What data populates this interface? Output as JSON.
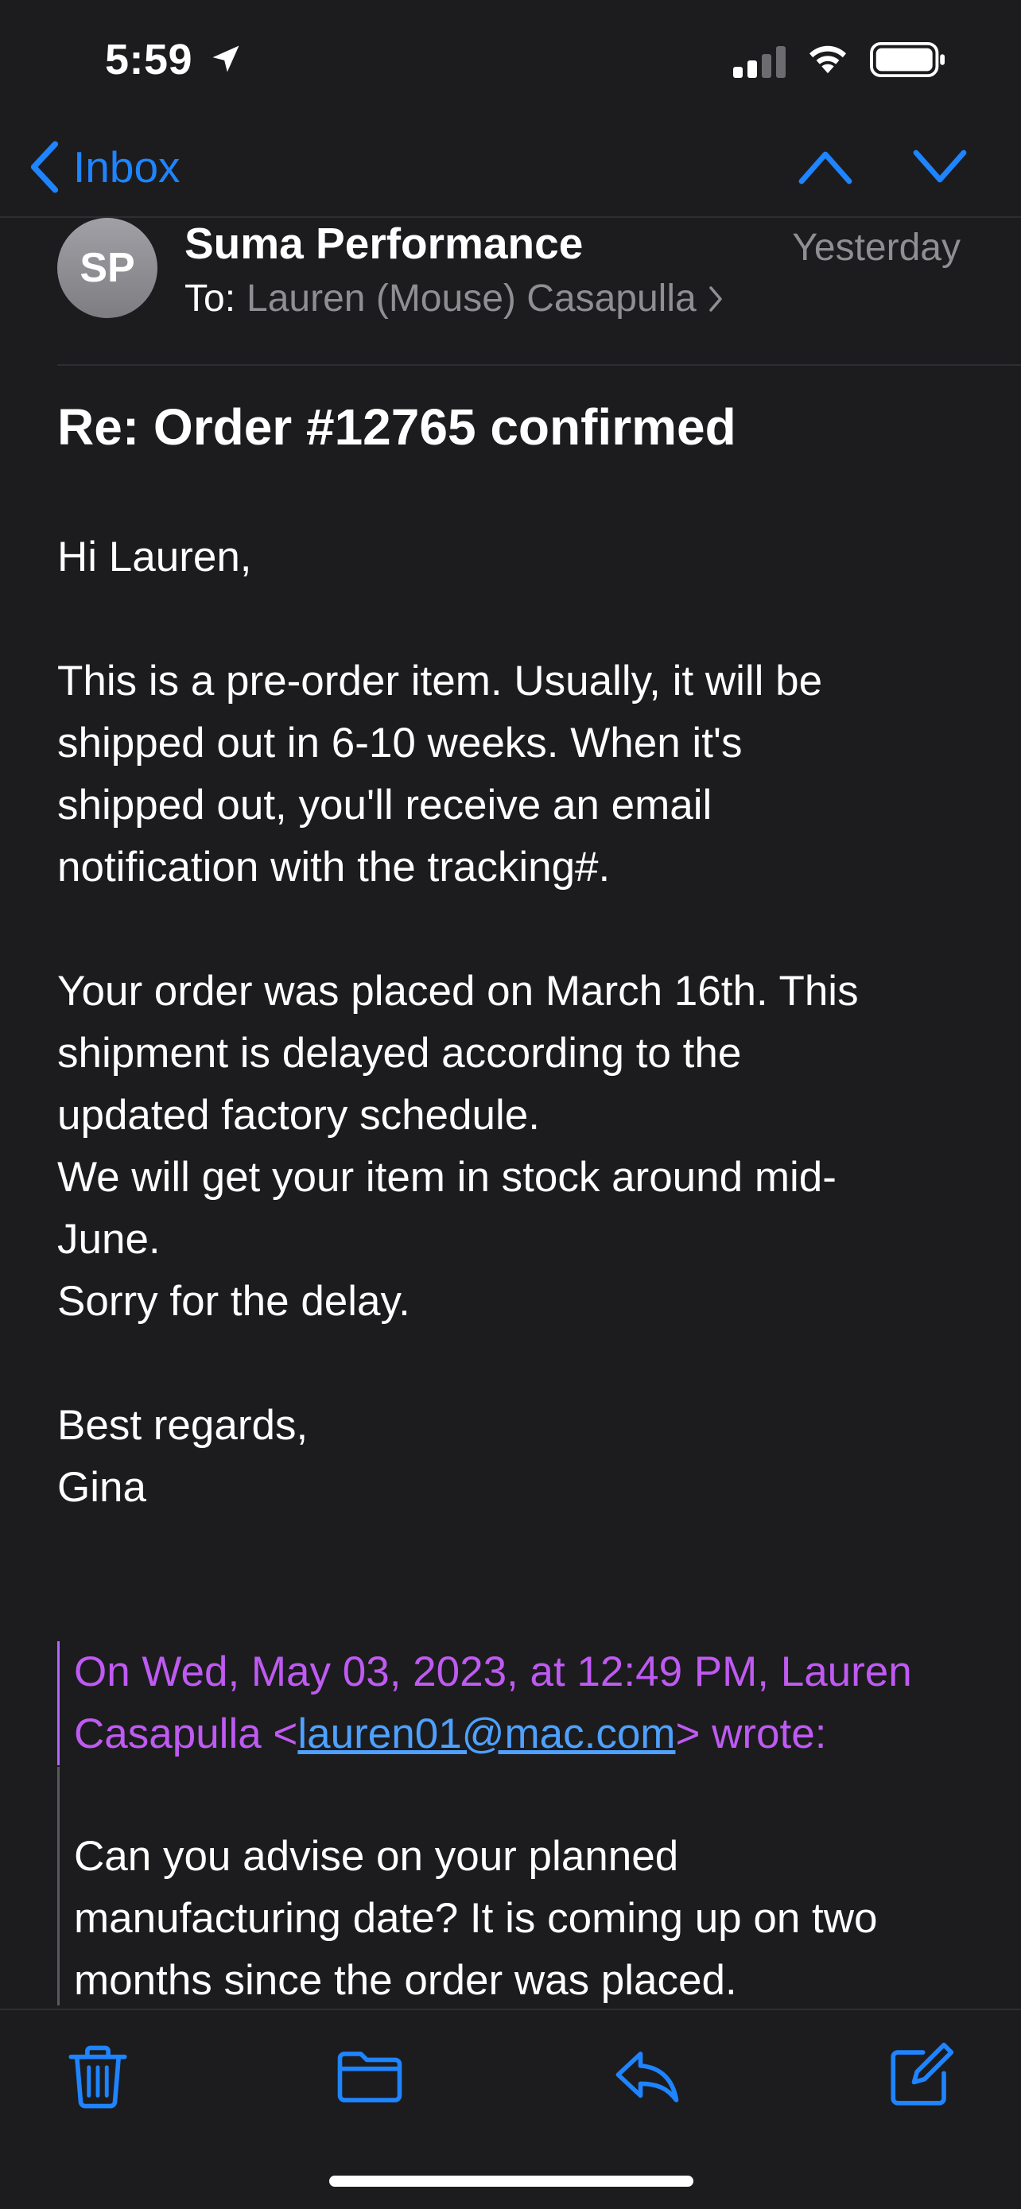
{
  "status_bar": {
    "time": "5:59",
    "icons": [
      "location-arrow-icon",
      "cellular-signal-icon",
      "wifi-icon",
      "battery-icon"
    ]
  },
  "nav": {
    "back_label": "Inbox",
    "icons": [
      "chevron-left-icon",
      "chevron-up-icon",
      "chevron-down-icon"
    ]
  },
  "email": {
    "avatar_initials": "SP",
    "sender": "Suma Performance",
    "date": "Yesterday",
    "to_label": "To:",
    "recipient": "Lauren (Mouse) Casapulla",
    "subject": "Re: Order #12765 confirmed",
    "greeting": "Hi Lauren,",
    "paragraph1": [
      "This is a pre-order item. Usually, it will be",
      "shipped out in 6-10 weeks. When it's",
      "shipped out, you'll receive an email",
      "notification with the tracking#."
    ],
    "paragraph2": [
      "Your order was placed on March 16th. This",
      "shipment is delayed according to the",
      "updated factory schedule.",
      "We will get your item in stock around mid-",
      "June.",
      "Sorry for the delay."
    ],
    "signoff": [
      "Best regards,",
      "Gina"
    ],
    "quote": {
      "header_line1": "On Wed, May 03, 2023, at 12:49 PM, Lauren",
      "header_line2_prefix": "Casapulla <",
      "email_link": "lauren01@mac.com",
      "header_line2_suffix": "> wrote:",
      "body": [
        "Can you advise on your planned",
        "manufacturing date? It is coming up on two",
        "months since the order was placed."
      ]
    }
  },
  "toolbar": {
    "icons": [
      "trash-icon",
      "folder-icon",
      "reply-icon",
      "compose-icon"
    ]
  },
  "colors": {
    "background": "#1c1c1e",
    "accent": "#1e84ff",
    "quote_header": "#bf5af2",
    "link": "#4ea1ff",
    "secondary_text": "#8e8e93"
  }
}
